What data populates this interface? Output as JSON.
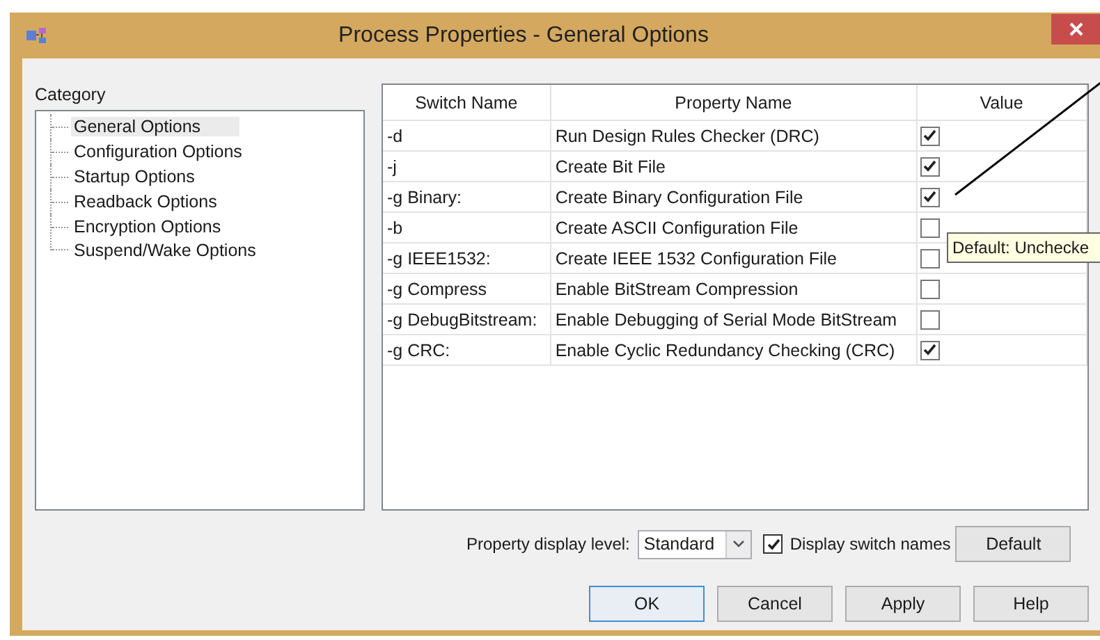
{
  "window": {
    "title": "Process Properties - General Options"
  },
  "category": {
    "label": "Category",
    "items": [
      {
        "label": "General Options",
        "selected": true
      },
      {
        "label": "Configuration Options",
        "selected": false
      },
      {
        "label": "Startup Options",
        "selected": false
      },
      {
        "label": "Readback Options",
        "selected": false
      },
      {
        "label": "Encryption Options",
        "selected": false
      },
      {
        "label": "Suspend/Wake Options",
        "selected": false
      }
    ]
  },
  "table": {
    "columns": [
      "Switch Name",
      "Property Name",
      "Value"
    ],
    "rows": [
      {
        "switch": "-d",
        "property": "Run Design Rules Checker (DRC)",
        "checked": true
      },
      {
        "switch": "-j",
        "property": "Create Bit File",
        "checked": true
      },
      {
        "switch": "-g Binary:",
        "property": "Create Binary Configuration File",
        "checked": true
      },
      {
        "switch": "-b",
        "property": "Create ASCII Configuration File",
        "checked": false
      },
      {
        "switch": "-g IEEE1532:",
        "property": "Create IEEE 1532 Configuration File",
        "checked": false
      },
      {
        "switch": "-g Compress",
        "property": "Enable BitStream Compression",
        "checked": false
      },
      {
        "switch": "-g DebugBitstream:",
        "property": "Enable Debugging of Serial Mode BitStream",
        "checked": false
      },
      {
        "switch": "-g CRC:",
        "property": "Enable Cyclic Redundancy Checking (CRC)",
        "checked": true
      }
    ]
  },
  "tooltip": "Default: Unchecke",
  "display_level": {
    "label": "Property display level:",
    "value": "Standard"
  },
  "display_switch_names": {
    "label": "Display switch names",
    "checked": true
  },
  "default_button": "Default",
  "buttons": [
    {
      "label": "OK",
      "focused": true
    },
    {
      "label": "Cancel",
      "focused": false
    },
    {
      "label": "Apply",
      "focused": false
    },
    {
      "label": "Help",
      "focused": false
    }
  ]
}
